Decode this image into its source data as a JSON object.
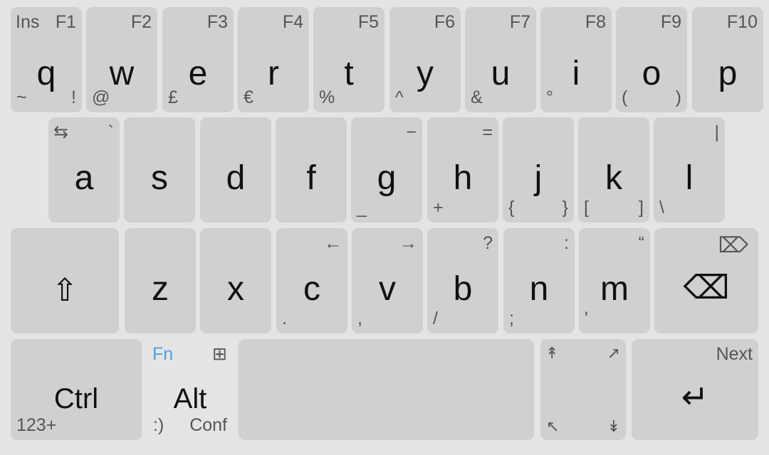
{
  "row1": [
    {
      "main": "q",
      "tl": "Ins",
      "tr": "F1",
      "bl": "~",
      "br": "!"
    },
    {
      "main": "w",
      "tr": "F2",
      "bl": "@"
    },
    {
      "main": "e",
      "tr": "F3",
      "bl": "£"
    },
    {
      "main": "r",
      "tr": "F4",
      "bl": "€"
    },
    {
      "main": "t",
      "tr": "F5",
      "bl": "%"
    },
    {
      "main": "y",
      "tr": "F6",
      "bl": "^"
    },
    {
      "main": "u",
      "tr": "F7",
      "bl": "&"
    },
    {
      "main": "i",
      "tr": "F8",
      "bl": "°"
    },
    {
      "main": "o",
      "tr": "F9",
      "bl": "(",
      "br": ")"
    },
    {
      "main": "p",
      "tr": "F10"
    }
  ],
  "row2": [
    {
      "main": "a",
      "tl": "⇆",
      "tr": "`"
    },
    {
      "main": "s"
    },
    {
      "main": "d"
    },
    {
      "main": "f"
    },
    {
      "main": "g",
      "tr": "−",
      "bl": "_"
    },
    {
      "main": "h",
      "tr": "=",
      "bl": "+"
    },
    {
      "main": "j",
      "bl": "{",
      "br": "}"
    },
    {
      "main": "k",
      "bl": "[",
      "br": "]"
    },
    {
      "main": "l",
      "tr": "|",
      "bl": "\\"
    }
  ],
  "row3": {
    "shift": {
      "main": "⇧"
    },
    "letters": [
      {
        "main": "z"
      },
      {
        "main": "x"
      },
      {
        "main": "c",
        "tr": "←",
        "bl": "."
      },
      {
        "main": "v",
        "tr": "→",
        "bl": ","
      },
      {
        "main": "b",
        "tr": "?",
        "bl": "/"
      },
      {
        "main": "n",
        "tr": ":",
        "bl": ";"
      },
      {
        "main": "m",
        "tr": "“",
        "bl": "'"
      }
    ],
    "backspace": {
      "main": "⌫",
      "sub": "⌦"
    }
  },
  "row4": {
    "ctrl": {
      "main": "Ctrl",
      "bl": "123+"
    },
    "alt": {
      "main": "Alt",
      "tl": "Fn",
      "tr": "⊞",
      "bl": ":)",
      "br": "Conf"
    },
    "space": {
      "main": ""
    },
    "nav": {
      "tl": "↟",
      "tr": "↗",
      "bl": "↖",
      "br": "↡"
    },
    "enter": {
      "main": "↵",
      "tr": "Next"
    }
  },
  "colors": {
    "background": "#e4e4e4",
    "key": "#d0d0d0",
    "fn_accent": "#4aa3df"
  }
}
